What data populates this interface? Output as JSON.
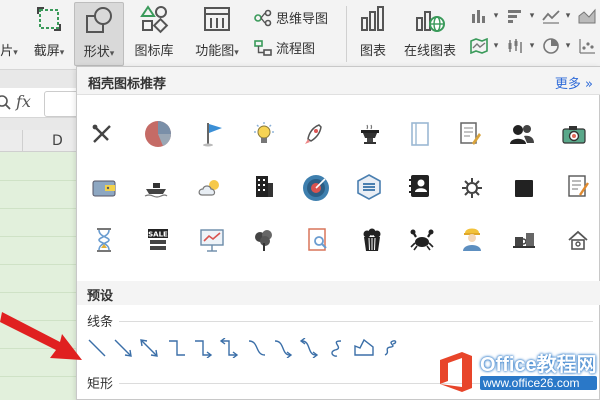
{
  "ribbon": {
    "left_cut_label": "片",
    "screenshot_label": "截屏",
    "shapes_label": "形状",
    "icon_library_label": "图标库",
    "function_chart_label": "功能图",
    "mindmap_label": "思维导图",
    "flowchart_label": "流程图",
    "chart_label": "图表",
    "online_chart_label": "在线图表"
  },
  "formula_bar": {
    "fx_label": "fx"
  },
  "sheet": {
    "column_label": "D"
  },
  "panel": {
    "title": "稻壳图标推荐",
    "more_label": "更多",
    "icons": [
      "tools-icon",
      "pie-chart-icon",
      "flag-icon",
      "lightbulb-icon",
      "rocket-icon",
      "hotpot-icon",
      "notebook-icon",
      "document-edit-icon",
      "users-icon",
      "camera-icon",
      "wallet-icon",
      "ship-icon",
      "cloud-sun-icon",
      "building-icon",
      "target-icon",
      "hexagon-menu-icon",
      "contact-book-icon",
      "gear-icon",
      "shopping-bag-icon",
      "checklist-icon",
      "hourglass-icon",
      "sale-sign-icon",
      "presentation-icon",
      "tree-icon",
      "search-document-icon",
      "popcorn-icon",
      "crab-icon",
      "worker-icon",
      "coffee-desk-icon",
      "house-icon"
    ],
    "preset_title": "预设",
    "lines_title": "线条",
    "rect_title": "矩形",
    "line_shapes": [
      "line-icon",
      "arrow-line-icon",
      "double-arrow-line-icon",
      "elbow-connector-icon",
      "elbow-arrow-icon",
      "elbow-double-arrow-icon",
      "curved-connector-icon",
      "curved-arrow-icon",
      "curved-double-arrow-icon",
      "curve-icon",
      "freeform-icon",
      "scribble-icon"
    ]
  },
  "watermark": {
    "name": "Office教程网",
    "url": "www.office26.com"
  },
  "colors": {
    "accent_blue": "#2f6bd8",
    "arrow_red": "#e02020",
    "sheet_green": "#e2f0dc"
  }
}
